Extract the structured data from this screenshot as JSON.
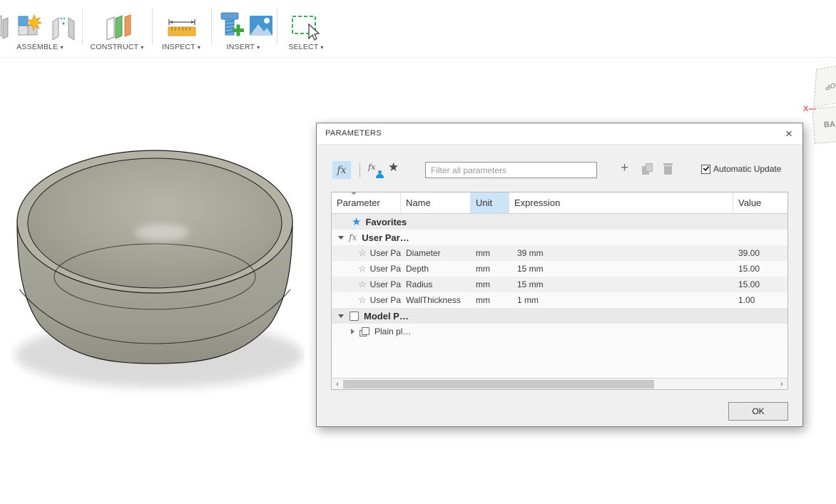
{
  "toolbar": {
    "caret": "▾",
    "groups": [
      {
        "label": "ASSEMBLE"
      },
      {
        "label": "CONSTRUCT"
      },
      {
        "label": "INSPECT"
      },
      {
        "label": "INSERT"
      },
      {
        "label": "SELECT"
      }
    ]
  },
  "viewcube": {
    "top_partial": "OP",
    "front_partial": "BA",
    "axis_x": "X"
  },
  "dialog": {
    "title": "PARAMETERS",
    "filter_placeholder": "Filter all parameters",
    "auto_update_label": "Automatic Update",
    "ok_label": "OK",
    "table": {
      "columns": [
        "Parameter",
        "Name",
        "Unit",
        "Expression",
        "Value"
      ],
      "rows": [
        {
          "label": "Favorites"
        },
        {
          "label": "User Par…"
        },
        {
          "parameter": "User Pa…",
          "name": "Diameter",
          "unit": "mm",
          "expression": "39 mm",
          "value": "39.00"
        },
        {
          "parameter": "User Pa…",
          "name": "Depth",
          "unit": "mm",
          "expression": "15 mm",
          "value": "15.00"
        },
        {
          "parameter": "User Pa…",
          "name": "Radius",
          "unit": "mm",
          "expression": "15 mm",
          "value": "15.00"
        },
        {
          "parameter": "User Pa…",
          "name": "WallThickness",
          "unit": "mm",
          "expression": "1 mm",
          "value": "1.00"
        },
        {
          "label": "Model P…"
        },
        {
          "label": "Plain pl…"
        }
      ]
    }
  },
  "icons": {
    "close": "×",
    "plus": "+",
    "star_filled": "★",
    "star_outline": "☆",
    "fx": "fx",
    "scroll_left": "‹",
    "scroll_right": "›"
  },
  "colors": {
    "accent_blue": "#1f97d4",
    "unit_column_highlight": "#cde4f6",
    "fx_selected_bg": "#c9e1f4",
    "favorites_star": "#2795e0",
    "axis_x_red": "#e2625e",
    "bowl_gray": "#a5a598"
  }
}
